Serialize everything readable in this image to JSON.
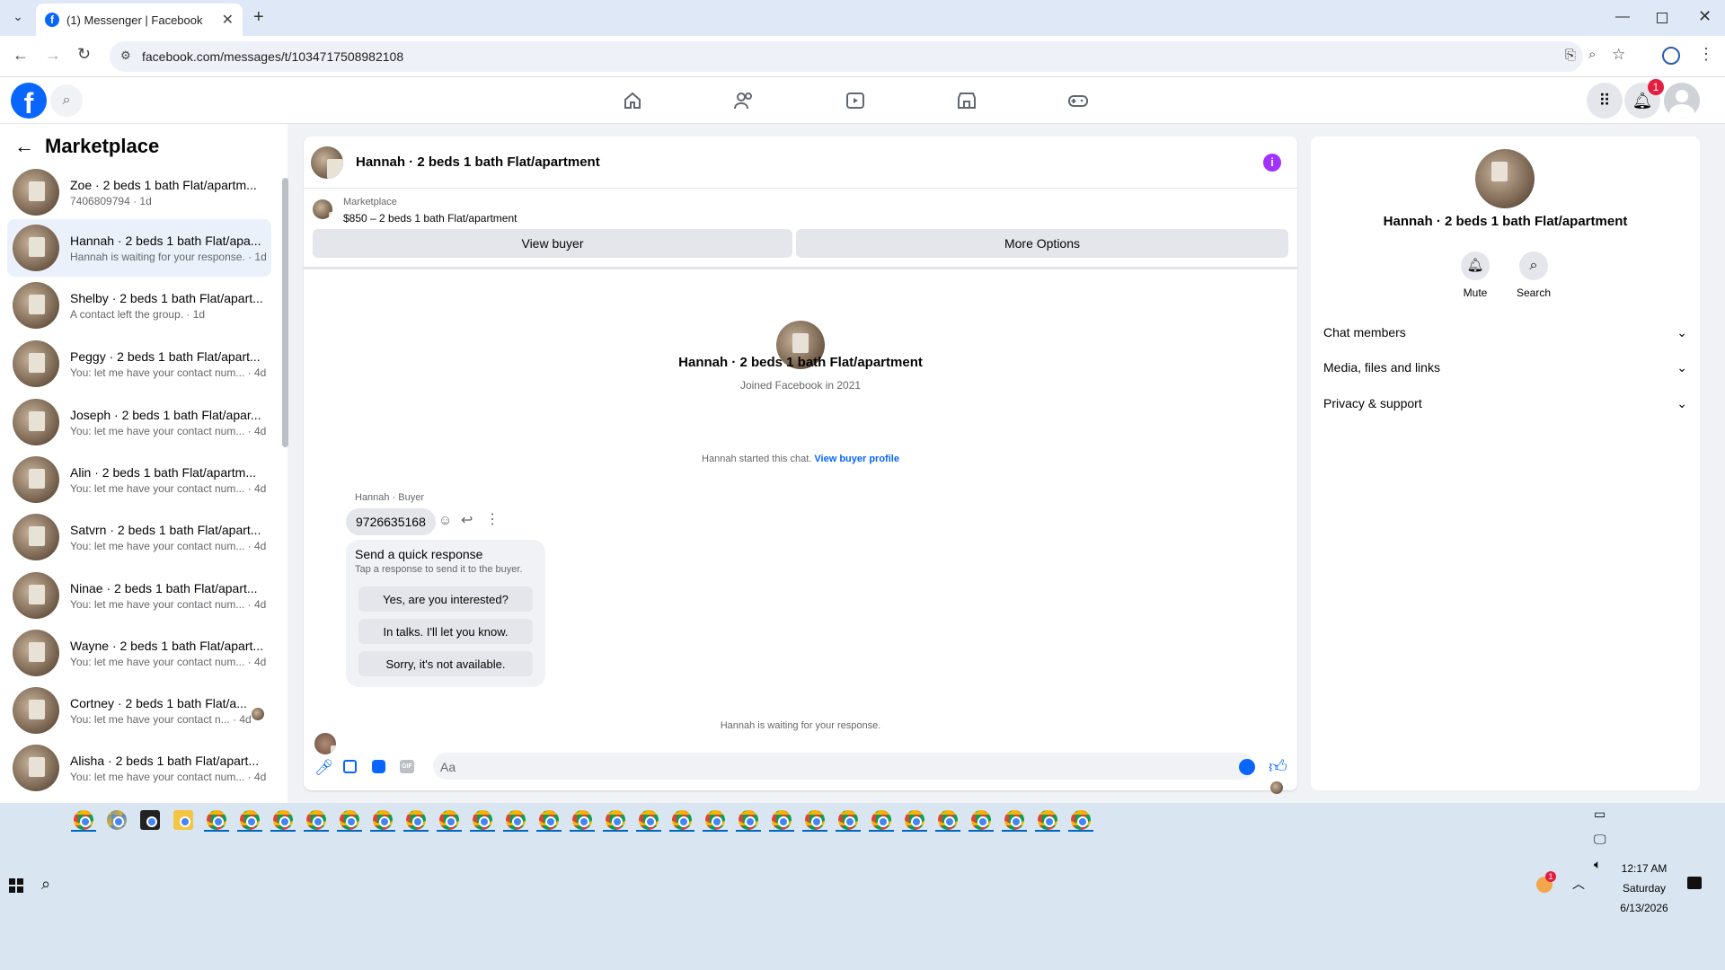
{
  "browser": {
    "tab_title": "(1) Messenger | Facebook",
    "url": "facebook.com/messages/t/1034717508982108"
  },
  "nav": {
    "notification_count": "1"
  },
  "sidebar": {
    "title": "Marketplace",
    "threads": [
      {
        "name": "Zoe · 2 beds 1 bath Flat/apartm...",
        "sub": "7406809794 · 1d"
      },
      {
        "name": "Hannah · 2 beds 1 bath Flat/apa...",
        "sub": "Hannah is waiting for your response. · 1d"
      },
      {
        "name": "Shelby · 2 beds 1 bath Flat/apart...",
        "sub": "A contact left the group. · 1d"
      },
      {
        "name": "Peggy · 2 beds 1 bath Flat/apart...",
        "sub": "You: let me have your contact num... · 4d"
      },
      {
        "name": "Joseph · 2 beds 1 bath Flat/apar...",
        "sub": "You: let me have your contact num... · 4d"
      },
      {
        "name": "Alin · 2 beds 1 bath Flat/apartm...",
        "sub": "You: let me have your contact num... · 4d"
      },
      {
        "name": "Satvrn · 2 beds 1 bath Flat/apart...",
        "sub": "You: let me have your contact num... · 4d"
      },
      {
        "name": "Ninae · 2 beds 1 bath Flat/apart...",
        "sub": "You: let me have your contact num... · 4d"
      },
      {
        "name": "Wayne · 2 beds 1 bath Flat/apart...",
        "sub": "You: let me have your contact num... · 4d"
      },
      {
        "name": "Cortney · 2 beds 1 bath Flat/a...",
        "sub": "You: let me have your contact n... · 4d"
      },
      {
        "name": "Alisha · 2 beds 1 bath Flat/apart...",
        "sub": "You: let me have your contact num... · 4d"
      }
    ]
  },
  "chat": {
    "header_title": "Hannah · 2 beds 1 bath Flat/apartment",
    "listing_source": "Marketplace",
    "listing_title": "$850 – 2 beds 1 bath Flat/apartment",
    "view_buyer": "View buyer",
    "more_options": "More Options",
    "profile_name": "Hannah · 2 beds 1 bath Flat/apartment",
    "joined": "Joined Facebook in 2021",
    "started_text": "Hannah started this chat.",
    "view_buyer_profile": "View buyer profile",
    "sender_label": "Hannah · Buyer",
    "message": "9726635168",
    "quick_title": "Send a quick response",
    "quick_sub": "Tap a response to send it to the buyer.",
    "quick_responses": [
      "Yes, are you interested?",
      "In talks. I'll let you know.",
      "Sorry, it's not available."
    ],
    "waiting": "Hannah is waiting for your response.",
    "composer_placeholder": "Aa"
  },
  "info_panel": {
    "name": "Hannah · 2 beds 1 bath Flat/apartment",
    "mute": "Mute",
    "search": "Search",
    "sections": [
      "Chat members",
      "Media, files and links",
      "Privacy & support"
    ]
  },
  "taskbar": {
    "time": "12:17 AM",
    "day": "Saturday",
    "date": "6/13/2026",
    "badge": "1"
  },
  "colors": {
    "accent": "#0866ff",
    "brand": "#0866ff",
    "purple": "#a033ff",
    "notif": "#e41e3f"
  }
}
